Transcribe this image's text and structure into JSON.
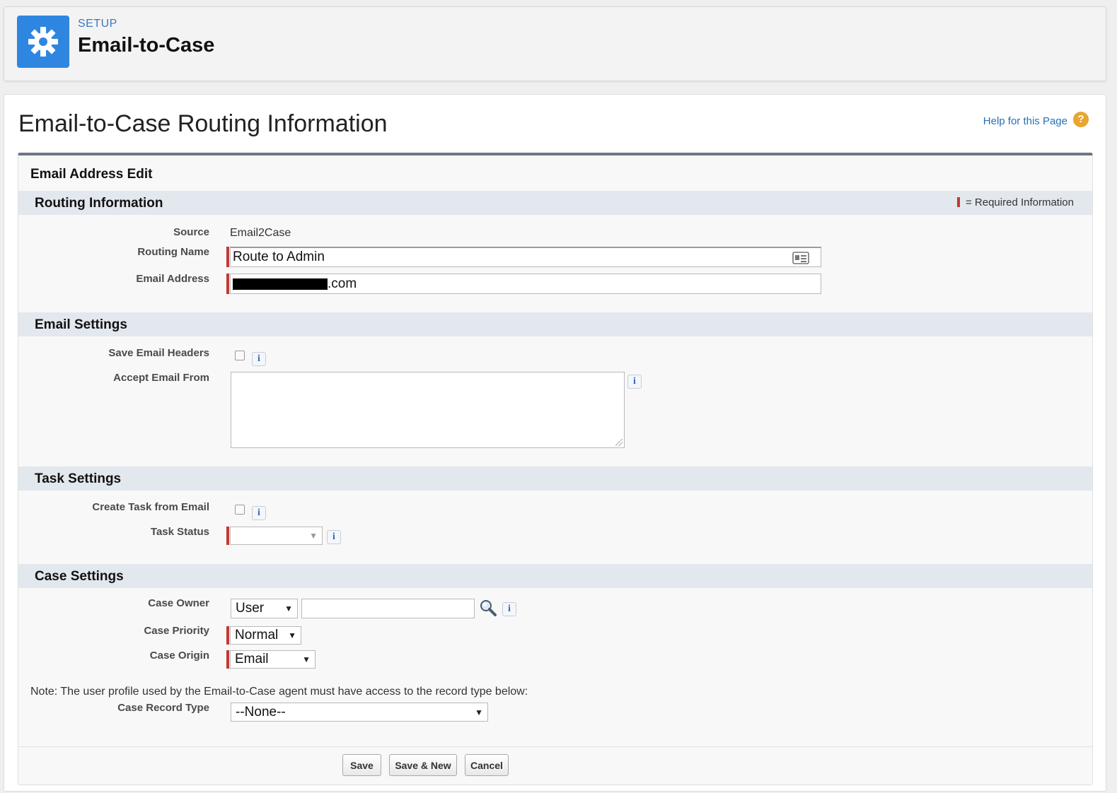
{
  "setup": {
    "eyebrow": "SETUP",
    "title": "Email-to-Case",
    "icon": "gear-icon",
    "icon_color": "#2f86e0"
  },
  "page": {
    "title": "Email-to-Case Routing Information",
    "help_label": "Help for this Page",
    "help_icon": "question-icon"
  },
  "block": {
    "title": "Email Address Edit"
  },
  "routing": {
    "section_title": "Routing Information",
    "required_legend": "= Required Information",
    "required_color": "#c23934",
    "source_label": "Source",
    "source_value": "Email2Case",
    "routing_name_label": "Routing Name",
    "routing_name_value": "Route to Admin",
    "email_label": "Email Address",
    "email_value_suffix": ".com"
  },
  "email_settings": {
    "section_title": "Email Settings",
    "save_headers_label": "Save Email Headers",
    "accept_from_label": "Accept Email From",
    "accept_from_value": ""
  },
  "task_settings": {
    "section_title": "Task Settings",
    "create_task_label": "Create Task from Email",
    "task_status_label": "Task Status",
    "task_status_value": ""
  },
  "case_settings": {
    "section_title": "Case Settings",
    "owner_label": "Case Owner",
    "owner_type": "User",
    "owner_value": "",
    "priority_label": "Case Priority",
    "priority_value": "Normal",
    "origin_label": "Case Origin",
    "origin_value": "Email",
    "note": "Note: The user profile used by the Email-to-Case agent must have access to the record type below:",
    "record_type_label": "Case Record Type",
    "record_type_value": "--None--"
  },
  "buttons": {
    "save": "Save",
    "save_new": "Save & New",
    "cancel": "Cancel"
  },
  "icons": {
    "info": "i",
    "arrow": "▼",
    "help": "?"
  }
}
